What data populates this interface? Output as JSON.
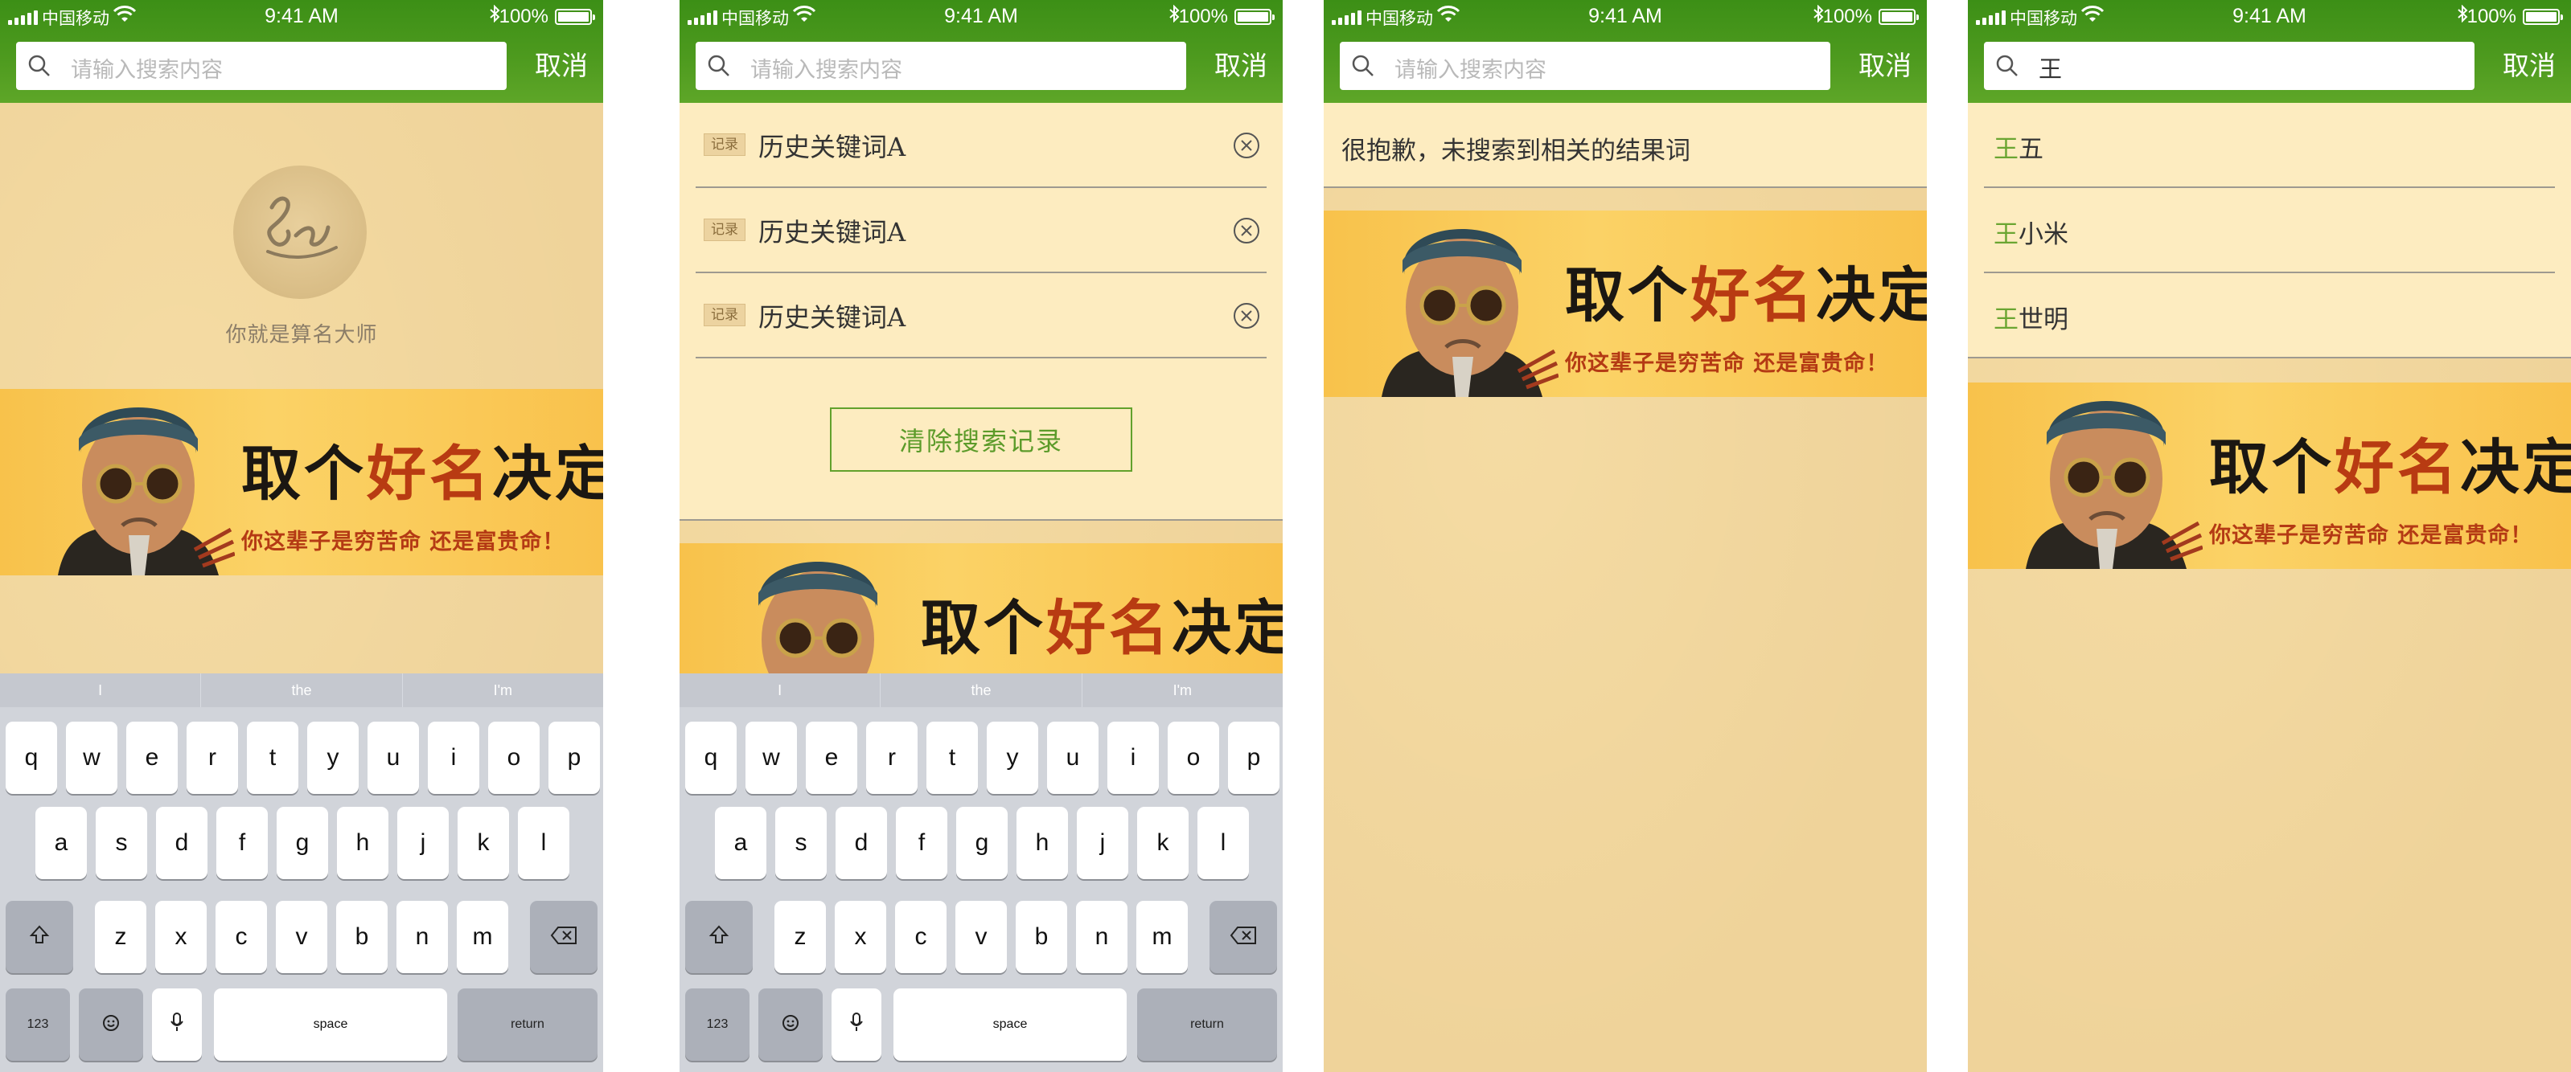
{
  "status_bar": {
    "carrier": "中国移动",
    "time": "9:41 AM",
    "battery": "100%",
    "battery_level": 1.0
  },
  "search": {
    "placeholder": "请输入搜索内容",
    "query": "王",
    "cancel_label": "取消"
  },
  "empty_state": {
    "caption": "你就是算名大师"
  },
  "banner": {
    "title_part1": "取个",
    "title_highlight": "好名",
    "title_part2": "决定",
    "subtitle": "你这辈子是穷苦命 还是富贵命！"
  },
  "history": {
    "tag": "记录",
    "items": [
      "历史关键词A",
      "历史关键词A",
      "历史关键词A"
    ],
    "clear_label": "清除搜索记录"
  },
  "no_result": {
    "message": "很抱歉，未搜索到相关的结果词"
  },
  "results": {
    "match": "王",
    "items": [
      {
        "match": "王",
        "rest": "五"
      },
      {
        "match": "王",
        "rest": "小米"
      },
      {
        "match": "王",
        "rest": "世明"
      }
    ]
  },
  "keyboard": {
    "suggestions": [
      "I",
      "the",
      "I'm"
    ],
    "row1": [
      "q",
      "w",
      "e",
      "r",
      "t",
      "y",
      "u",
      "i",
      "o",
      "p"
    ],
    "row2": [
      "a",
      "s",
      "d",
      "f",
      "g",
      "h",
      "j",
      "k",
      "l"
    ],
    "row3": [
      "z",
      "x",
      "c",
      "v",
      "b",
      "n",
      "m"
    ],
    "shift_icon": "shift-icon",
    "delete_icon": "backspace-icon",
    "numbers_label": "123",
    "emoji_icon": "emoji-icon",
    "mic_icon": "microphone-icon",
    "space_label": "space",
    "return_label": "return"
  },
  "colors": {
    "header_green": "#4d9a1e",
    "background": "#efd39a",
    "list_background": "#fdecc0",
    "accent_green": "#5c9b2a",
    "banner_red": "#b83b12"
  }
}
